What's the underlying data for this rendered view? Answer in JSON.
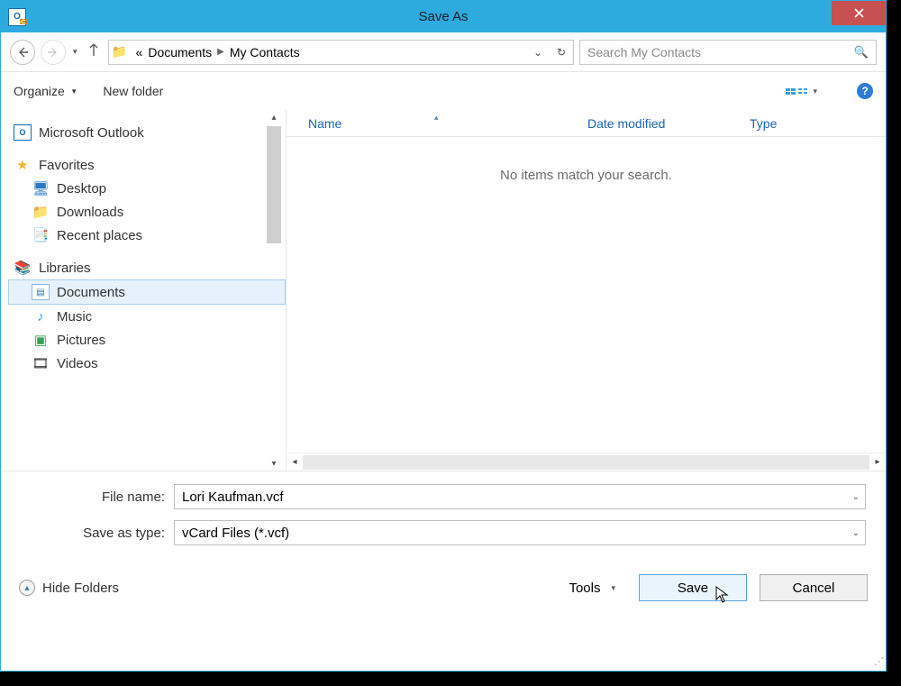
{
  "window": {
    "title": "Save As"
  },
  "breadcrumb": {
    "seg1": "Documents",
    "seg2": "My Contacts",
    "prefix": "«"
  },
  "search": {
    "placeholder": "Search My Contacts"
  },
  "toolbar": {
    "organize": "Organize",
    "new_folder": "New folder"
  },
  "sidebar": {
    "outlook": "Microsoft Outlook",
    "favorites": "Favorites",
    "fav_items": [
      "Desktop",
      "Downloads",
      "Recent places"
    ],
    "libraries": "Libraries",
    "lib_items": [
      "Documents",
      "Music",
      "Pictures",
      "Videos"
    ]
  },
  "columns": {
    "name": "Name",
    "date": "Date modified",
    "type": "Type"
  },
  "empty": "No items match your search.",
  "form": {
    "file_label": "File name:",
    "file_value": "Lori Kaufman.vcf",
    "type_label": "Save as type:",
    "type_value": "vCard Files (*.vcf)"
  },
  "bottom": {
    "hide": "Hide Folders",
    "tools": "Tools",
    "save": "Save",
    "cancel": "Cancel"
  }
}
